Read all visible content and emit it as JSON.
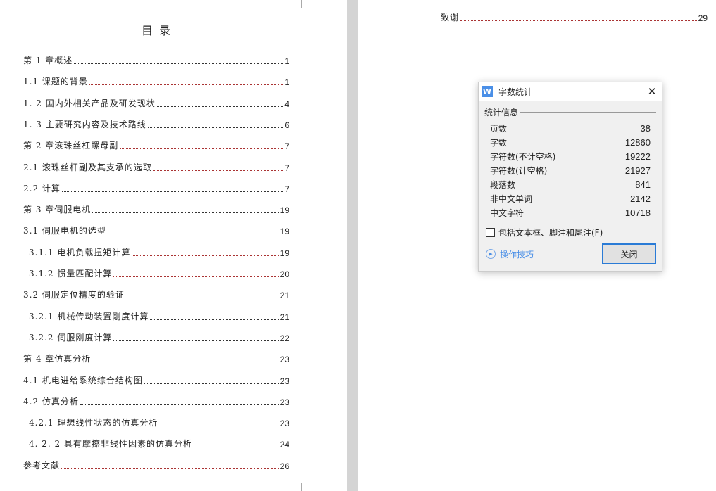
{
  "toc": {
    "title": "目 录",
    "entries": [
      {
        "text": "第 1 章概述 ",
        "page": "1",
        "level": 1,
        "red": false
      },
      {
        "text": "1.1 课题的背景",
        "page": "1",
        "level": 1,
        "red": true
      },
      {
        "text": "1. 2 国内外相关产品及研发现状 ",
        "page": "4",
        "level": 1,
        "red": false
      },
      {
        "text": "1. 3 主要研究内容及技术路线",
        "page": "6",
        "level": 1,
        "red": false
      },
      {
        "text": "第 2 章滚珠丝杠螺母副",
        "page": "7",
        "level": 1,
        "red": true
      },
      {
        "text": "2.1 滚珠丝杆副及其支承的选取",
        "page": "7",
        "level": 1,
        "red": true
      },
      {
        "text": "2.2 计算 ",
        "page": "7",
        "level": 1,
        "red": false
      },
      {
        "text": "第 3 章伺服电机",
        "page": "19",
        "level": 1,
        "red": false
      },
      {
        "text": "3.1 伺服电机的选型 ",
        "page": "19",
        "level": 1,
        "red": true
      },
      {
        "text": "3.1.1 电机负载扭矩计算 ",
        "page": "19",
        "level": 2,
        "red": true
      },
      {
        "text": "3.1.2 惯量匹配计算",
        "page": "20",
        "level": 2,
        "red": true
      },
      {
        "text": "3.2 伺服定位精度的验证 ",
        "page": "21",
        "level": 1,
        "red": true
      },
      {
        "text": "3.2.1 机械传动装置刚度计算 ",
        "page": "21",
        "level": 2,
        "red": false
      },
      {
        "text": "3.2.2 伺服刚度计算",
        "page": "22",
        "level": 2,
        "red": false
      },
      {
        "text": "第 4 章仿真分析 ",
        "page": "23",
        "level": 1,
        "red": true
      },
      {
        "text": "4.1  机电进给系统综合结构图 ",
        "page": "23",
        "level": 1,
        "red": false
      },
      {
        "text": "4.2 仿真分析",
        "page": "23",
        "level": 1,
        "red": false
      },
      {
        "text": "4.2.1  理想线性状态的仿真分析 ",
        "page": "23",
        "level": 2,
        "red": false
      },
      {
        "text": "4. 2. 2  具有摩擦非线性因素的仿真分析 ",
        "page": "24",
        "level": 2,
        "red": false
      },
      {
        "text": "参考文献 ",
        "page": "26",
        "level": 1,
        "red": true
      }
    ]
  },
  "page2": {
    "entry": {
      "text": "致谢",
      "page": "29"
    }
  },
  "dialog": {
    "title": "字数统计",
    "app_icon": "W",
    "section": "统计信息",
    "stats": [
      {
        "label": "页数",
        "value": "38"
      },
      {
        "label": "字数",
        "value": "12860"
      },
      {
        "label": "字符数(不计空格)",
        "value": "19222"
      },
      {
        "label": "字符数(计空格)",
        "value": "21927"
      },
      {
        "label": "段落数",
        "value": "841"
      },
      {
        "label": "非中文单词",
        "value": "2142"
      },
      {
        "label": "中文字符",
        "value": "10718"
      }
    ],
    "checkbox_label": "包括文本框、脚注和尾注(F)",
    "checkbox_checked": false,
    "tips_label": "操作技巧",
    "close_label": "关闭"
  },
  "colors": {
    "accent": "#2a7bd6",
    "leader_red": "#a33"
  }
}
